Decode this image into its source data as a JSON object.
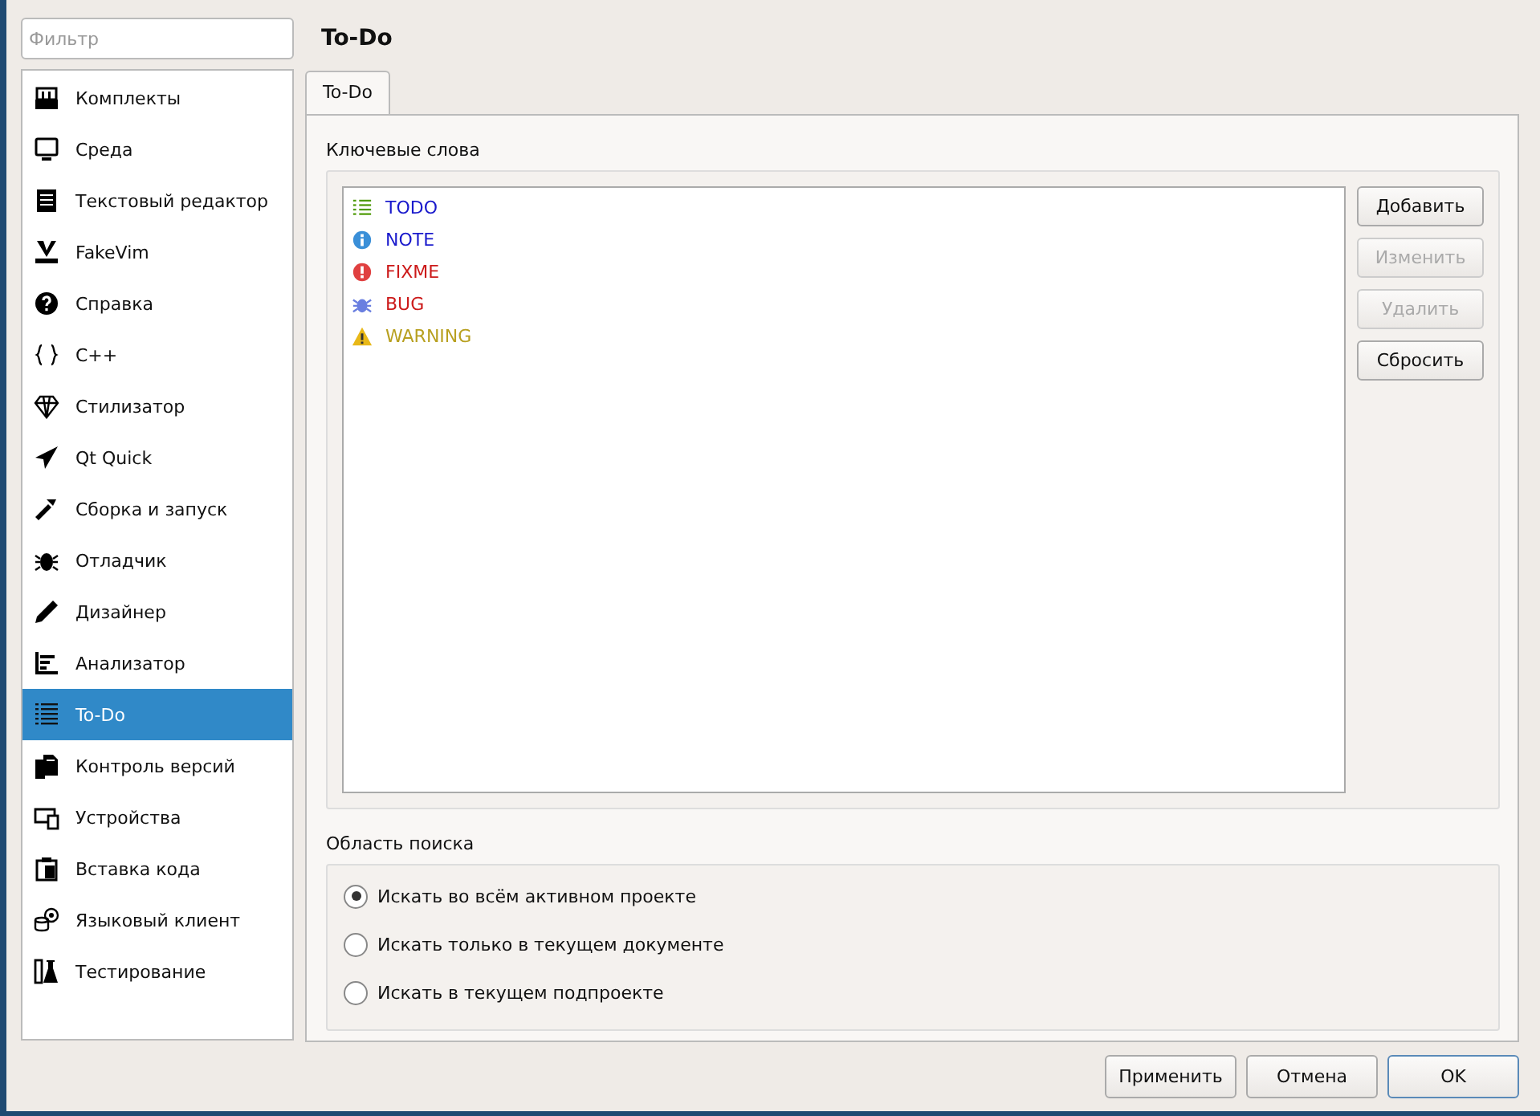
{
  "filter": {
    "placeholder": "Фильтр"
  },
  "sidebar": {
    "items": [
      {
        "label": "Комплекты",
        "selected": false
      },
      {
        "label": "Среда",
        "selected": false
      },
      {
        "label": "Текстовый редактор",
        "selected": false
      },
      {
        "label": "FakeVim",
        "selected": false
      },
      {
        "label": "Справка",
        "selected": false
      },
      {
        "label": "C++",
        "selected": false
      },
      {
        "label": "Стилизатор",
        "selected": false
      },
      {
        "label": "Qt Quick",
        "selected": false
      },
      {
        "label": "Сборка и запуск",
        "selected": false
      },
      {
        "label": "Отладчик",
        "selected": false
      },
      {
        "label": "Дизайнер",
        "selected": false
      },
      {
        "label": "Анализатор",
        "selected": false
      },
      {
        "label": "To-Do",
        "selected": true
      },
      {
        "label": "Контроль версий",
        "selected": false
      },
      {
        "label": "Устройства",
        "selected": false
      },
      {
        "label": "Вставка кода",
        "selected": false
      },
      {
        "label": "Языковый клиент",
        "selected": false
      },
      {
        "label": "Тестирование",
        "selected": false
      }
    ]
  },
  "page_title": "To-Do",
  "tabs": [
    {
      "label": "To-Do",
      "selected": true
    }
  ],
  "keywords": {
    "title": "Ключевые слова",
    "items": [
      {
        "kind": "list",
        "label": "TODO",
        "color": "#1a1acc"
      },
      {
        "kind": "info",
        "label": "NOTE",
        "color": "#1a1acc"
      },
      {
        "kind": "error",
        "label": "FIXME",
        "color": "#cc1a1a"
      },
      {
        "kind": "bug",
        "label": "BUG",
        "color": "#cc1a1a"
      },
      {
        "kind": "warning",
        "label": "WARNING",
        "color": "#b8a020"
      }
    ],
    "buttons": [
      {
        "label": "Добавить",
        "disabled": false
      },
      {
        "label": "Изменить",
        "disabled": true
      },
      {
        "label": "Удалить",
        "disabled": true
      },
      {
        "label": "Сбросить",
        "disabled": false
      }
    ]
  },
  "scope": {
    "title": "Область поиска",
    "options": [
      {
        "label": "Искать во всём активном проекте",
        "selected": true
      },
      {
        "label": "Искать только в текущем документе",
        "selected": false
      },
      {
        "label": "Искать в текущем подпроекте",
        "selected": false
      }
    ]
  },
  "footer_buttons": [
    {
      "label": "Применить",
      "default": false
    },
    {
      "label": "Отмена",
      "default": false
    },
    {
      "label": "OK",
      "default": true
    }
  ]
}
